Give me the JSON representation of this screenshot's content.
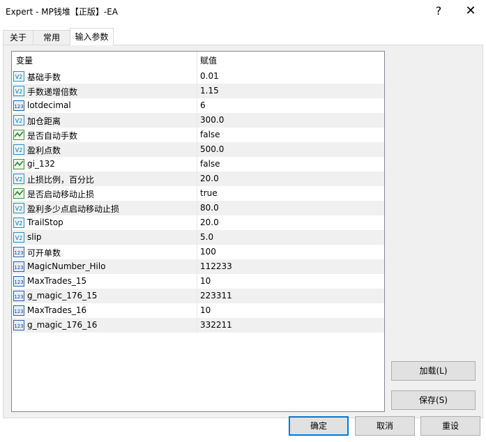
{
  "window": {
    "title": "Expert - MP钱堆【正版】-EA",
    "help": "?",
    "close": "✕"
  },
  "tabs": [
    {
      "label": "关于"
    },
    {
      "label": "常用"
    },
    {
      "label": "输入参数"
    }
  ],
  "grid": {
    "header": {
      "variable": "变量",
      "value": "赋值"
    },
    "rows": [
      {
        "name": "基础手数",
        "value": "0.01",
        "icon": "double-value-icon"
      },
      {
        "name": "手数递增倍数",
        "value": "1.15",
        "icon": "double-value-icon"
      },
      {
        "name": "lotdecimal",
        "value": "6",
        "icon": "integer-value-icon"
      },
      {
        "name": "加仓距离",
        "value": "300.0",
        "icon": "double-value-icon"
      },
      {
        "name": "是否自动手数",
        "value": "false",
        "icon": "boolean-value-icon"
      },
      {
        "name": "盈利点数",
        "value": "500.0",
        "icon": "double-value-icon"
      },
      {
        "name": "gi_132",
        "value": "false",
        "icon": "boolean-value-icon"
      },
      {
        "name": "止损比例，百分比",
        "value": "20.0",
        "icon": "double-value-icon"
      },
      {
        "name": "是否启动移动止损",
        "value": "true",
        "icon": "boolean-value-icon"
      },
      {
        "name": "盈利多少点启动移动止损",
        "value": "80.0",
        "icon": "double-value-icon"
      },
      {
        "name": "TrailStop",
        "value": "20.0",
        "icon": "double-value-icon"
      },
      {
        "name": "slip",
        "value": "5.0",
        "icon": "double-value-icon"
      },
      {
        "name": "可开单数",
        "value": "100",
        "icon": "integer-value-icon"
      },
      {
        "name": "MagicNumber_Hilo",
        "value": "112233",
        "icon": "integer-value-icon"
      },
      {
        "name": "MaxTrades_15",
        "value": "10",
        "icon": "integer-value-icon"
      },
      {
        "name": "g_magic_176_15",
        "value": "223311",
        "icon": "integer-value-icon"
      },
      {
        "name": "MaxTrades_16",
        "value": "10",
        "icon": "integer-value-icon"
      },
      {
        "name": "g_magic_176_16",
        "value": "332211",
        "icon": "integer-value-icon"
      }
    ]
  },
  "side_buttons": {
    "load": "加载(L)",
    "save": "保存(S)"
  },
  "footer_buttons": {
    "ok": "确定",
    "cancel": "取消",
    "reset": "重设"
  }
}
